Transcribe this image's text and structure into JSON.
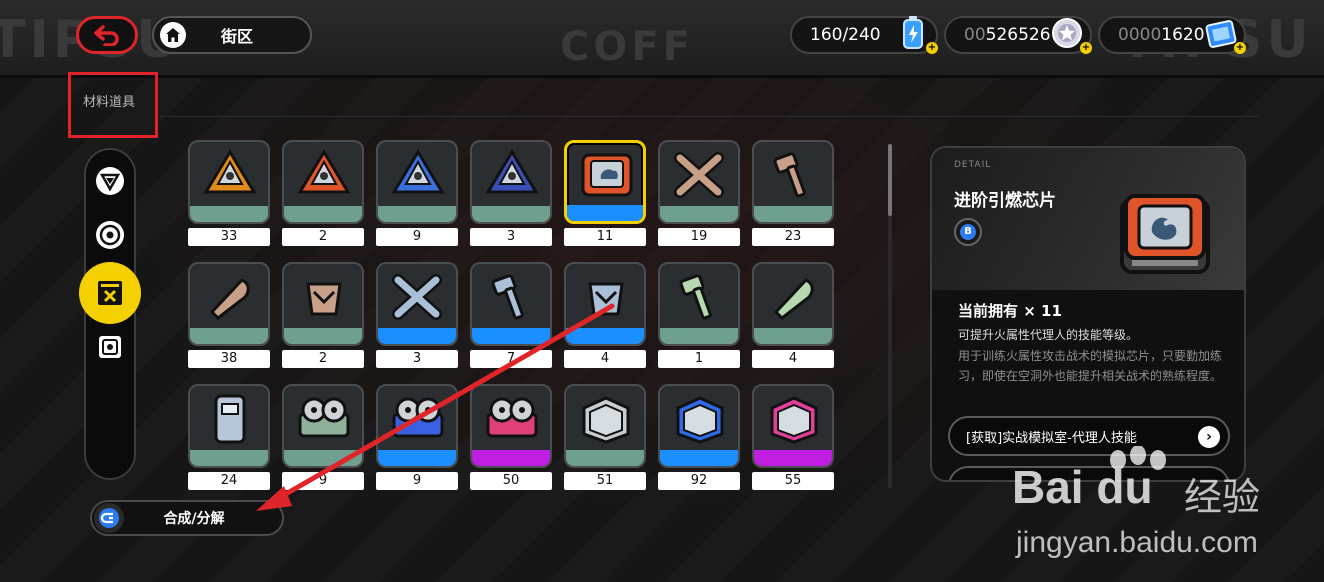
{
  "header": {
    "location_title": "街区",
    "resources": [
      {
        "name": "energy",
        "prefix": "",
        "value": "160/240",
        "color": "#3aa0ff"
      },
      {
        "name": "currency",
        "prefix": "00",
        "value": "526526",
        "color": "#c8c8d8"
      },
      {
        "name": "tickets",
        "prefix": "0000",
        "value": "1620",
        "color": "#2f8cff"
      }
    ]
  },
  "section": {
    "label": "材料道具"
  },
  "rail": {
    "items": [
      {
        "name": "rail-item-agent-materials",
        "icon": "triangle-shield-icon",
        "active": false
      },
      {
        "name": "rail-item-disc-materials",
        "icon": "disc-icon",
        "active": false
      },
      {
        "name": "rail-item-skill-materials",
        "icon": "chip-box-icon",
        "active": true
      },
      {
        "name": "rail-item-safe",
        "icon": "safe-icon",
        "active": false
      }
    ]
  },
  "items": [
    {
      "count": "33",
      "color": "#e08a1a",
      "strip": "#6fa08f",
      "shape": "tri"
    },
    {
      "count": "2",
      "color": "#e0542a",
      "strip": "#6fa08f",
      "shape": "tri"
    },
    {
      "count": "9",
      "color": "#3a6fe0",
      "strip": "#6fa08f",
      "shape": "tri"
    },
    {
      "count": "3",
      "color": "#3a4fb8",
      "strip": "#6fa08f",
      "shape": "tri"
    },
    {
      "count": "11",
      "color": "#e0542a",
      "strip": "#1c8fff",
      "shape": "chip",
      "selected": true
    },
    {
      "count": "19",
      "color": "#c8a088",
      "strip": "#6fa08f",
      "shape": "cross"
    },
    {
      "count": "23",
      "color": "#c8a088",
      "strip": "#6fa08f",
      "shape": "hammer"
    },
    {
      "count": "38",
      "color": "#c8a088",
      "strip": "#6fa08f",
      "shape": "blade"
    },
    {
      "count": "2",
      "color": "#c8a088",
      "strip": "#6fa08f",
      "shape": "fist"
    },
    {
      "count": "3",
      "color": "#a9c0d8",
      "strip": "#1c8fff",
      "shape": "cross"
    },
    {
      "count": "7",
      "color": "#a9c0d8",
      "strip": "#1c8fff",
      "shape": "hammer"
    },
    {
      "count": "4",
      "color": "#a9c0d8",
      "strip": "#1c8fff",
      "shape": "fist"
    },
    {
      "count": "1",
      "color": "#b8d8b0",
      "strip": "#6fa08f",
      "shape": "hammer"
    },
    {
      "count": "4",
      "color": "#b8d8b0",
      "strip": "#6fa08f",
      "shape": "blade"
    },
    {
      "count": "24",
      "color": "#b7c6d8",
      "strip": "#6fa08f",
      "shape": "canister"
    },
    {
      "count": "9",
      "color": "#8fb09a",
      "strip": "#6fa08f",
      "shape": "reel"
    },
    {
      "count": "9",
      "color": "#3a5fe0",
      "strip": "#1c8fff",
      "shape": "reel"
    },
    {
      "count": "50",
      "color": "#e0407a",
      "strip": "#c01ee0",
      "shape": "reel"
    },
    {
      "count": "51",
      "color": "#c8cdd0",
      "strip": "#6fa08f",
      "shape": "device"
    },
    {
      "count": "92",
      "color": "#2f6be8",
      "strip": "#1c8fff",
      "shape": "device"
    },
    {
      "count": "55",
      "color": "#e0409a",
      "strip": "#c01ee0",
      "shape": "device"
    }
  ],
  "detail": {
    "tag": "DETAIL",
    "name": "进阶引燃芯片",
    "rank": "B",
    "owned": "当前拥有 × 11",
    "desc_main": "可提升火属性代理人的技能等级。",
    "desc_flavor": "用于训练火属性攻击战术的模拟芯片，只要勤加练习，即使在空洞外也能提升相关战术的熟练程度。",
    "source_label": "[获取]实战模拟室-代理人技能",
    "color": "#e0542a"
  },
  "footer": {
    "synth_label": "合成/分解"
  },
  "watermark": {
    "brand": "Bai du",
    "jingyan": "经验",
    "url": "jingyan.baidu.com"
  },
  "annotation_color": "#e0252a"
}
